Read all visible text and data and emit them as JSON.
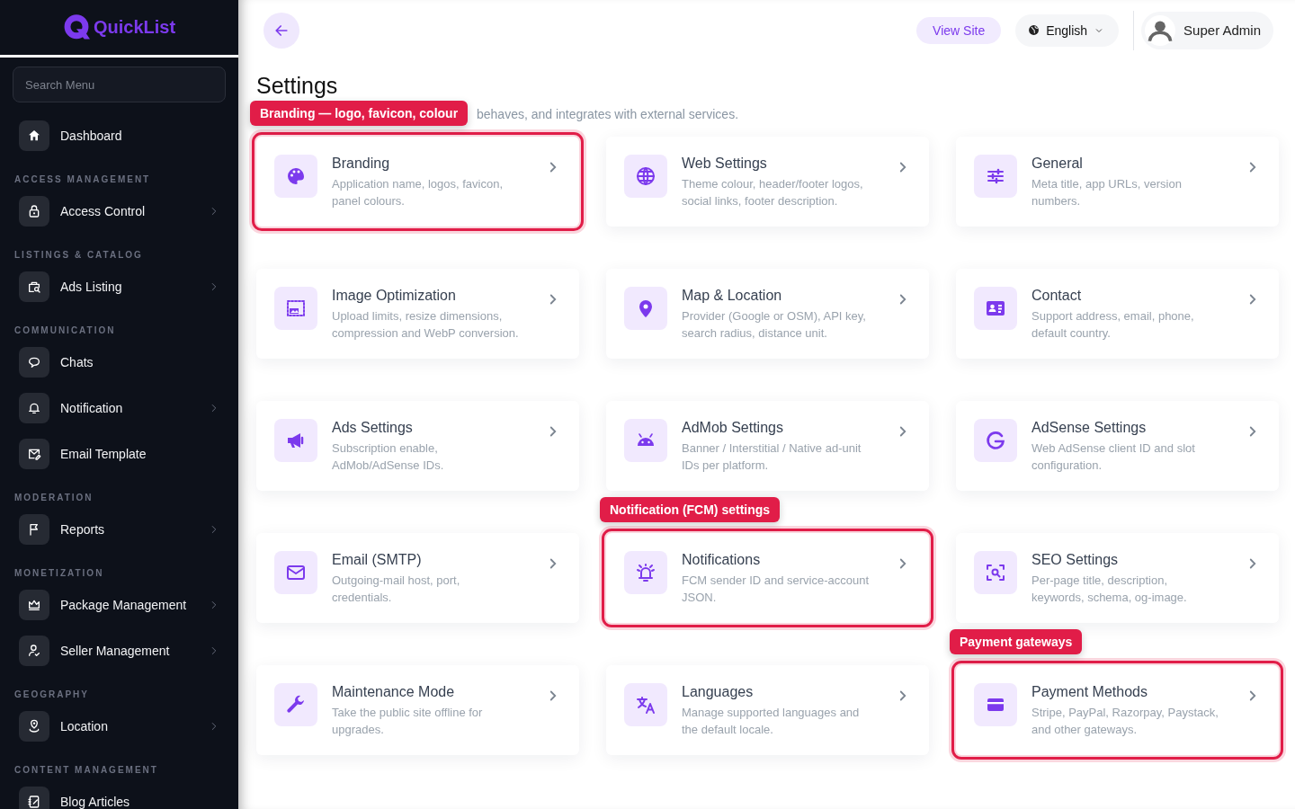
{
  "brand": {
    "name": "QuickList"
  },
  "sidebar": {
    "search": {
      "placeholder": "Search Menu"
    },
    "sections": [
      {
        "items": [
          {
            "label": "Dashboard",
            "has_submenu": false
          }
        ]
      },
      {
        "heading": "ACCESS MANAGEMENT",
        "items": [
          {
            "label": "Access Control",
            "has_submenu": true
          }
        ]
      },
      {
        "heading": "LISTINGS & CATALOG",
        "items": [
          {
            "label": "Ads Listing",
            "has_submenu": true
          }
        ]
      },
      {
        "heading": "COMMUNICATION",
        "items": [
          {
            "label": "Chats",
            "has_submenu": false
          },
          {
            "label": "Notification",
            "has_submenu": true
          },
          {
            "label": "Email Template",
            "has_submenu": false
          }
        ]
      },
      {
        "heading": "MODERATION",
        "items": [
          {
            "label": "Reports",
            "has_submenu": true
          }
        ]
      },
      {
        "heading": "MONETIZATION",
        "items": [
          {
            "label": "Package Management",
            "has_submenu": true
          },
          {
            "label": "Seller Management",
            "has_submenu": true
          }
        ]
      },
      {
        "heading": "GEOGRAPHY",
        "items": [
          {
            "label": "Location",
            "has_submenu": true
          }
        ]
      },
      {
        "heading": "CONTENT MANAGEMENT",
        "items": [
          {
            "label": "Blog Articles",
            "has_submenu": false
          }
        ]
      }
    ]
  },
  "topbar": {
    "view_site": "View Site",
    "language": "English",
    "user": "Super Admin"
  },
  "page": {
    "title": "Settings",
    "subtitle": "behaves, and integrates with external services."
  },
  "cards": [
    {
      "title": "Branding",
      "description": "Application name, logos, favicon, panel colours.",
      "highlighted": true,
      "callout": "Branding — logo, favicon, colour"
    },
    {
      "title": "Web Settings",
      "description": "Theme colour, header/footer logos, social links, footer description.",
      "highlighted": false
    },
    {
      "title": "General",
      "description": "Meta title, app URLs, version numbers.",
      "highlighted": false
    },
    {
      "title": "Image Optimization",
      "description": "Upload limits, resize dimensions, compression and WebP conversion.",
      "highlighted": false
    },
    {
      "title": "Map & Location",
      "description": "Provider (Google or OSM), API key, search radius, distance unit.",
      "highlighted": false
    },
    {
      "title": "Contact",
      "description": "Support address, email, phone, default country.",
      "highlighted": false
    },
    {
      "title": "Ads Settings",
      "description": "Subscription enable, AdMob/AdSense IDs.",
      "highlighted": false
    },
    {
      "title": "AdMob Settings",
      "description": "Banner / Interstitial / Native ad-unit IDs per platform.",
      "highlighted": false
    },
    {
      "title": "AdSense Settings",
      "description": "Web AdSense client ID and slot configuration.",
      "highlighted": false
    },
    {
      "title": "Email (SMTP)",
      "description": "Outgoing-mail host, port, credentials.",
      "highlighted": false
    },
    {
      "title": "Notifications",
      "description": "FCM sender ID and service-account JSON.",
      "highlighted": true,
      "callout": "Notification (FCM) settings"
    },
    {
      "title": "SEO Settings",
      "description": "Per-page title, description, keywords, schema, og-image.",
      "highlighted": false
    },
    {
      "title": "Maintenance Mode",
      "description": "Take the public site offline for upgrades.",
      "highlighted": false
    },
    {
      "title": "Languages",
      "description": "Manage supported languages and the default locale.",
      "highlighted": false
    },
    {
      "title": "Payment Methods",
      "description": "Stripe, PayPal, Razorpay, Paystack, and other gateways.",
      "highlighted": true,
      "callout": "Payment gateways"
    }
  ]
}
